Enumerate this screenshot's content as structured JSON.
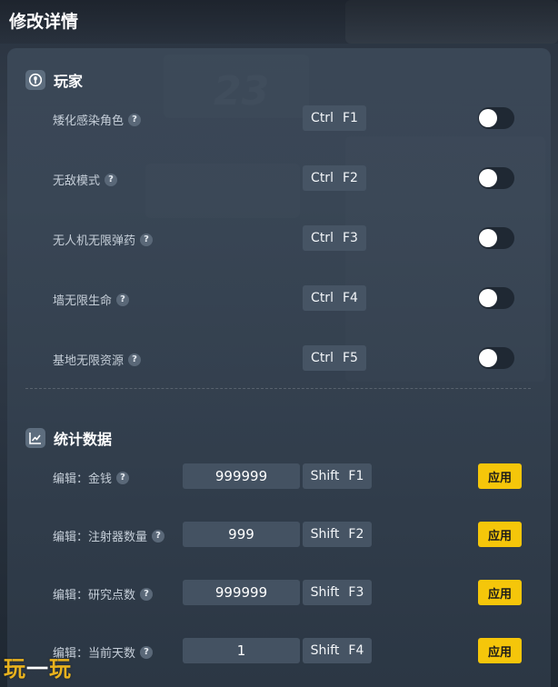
{
  "page": {
    "title": "修改详情"
  },
  "sections": {
    "player": {
      "title": "玩家",
      "icon": "player-icon",
      "items": [
        {
          "label": "矮化感染角色",
          "modifier": "Ctrl",
          "key": "F1",
          "enabled": false
        },
        {
          "label": "无敌模式",
          "modifier": "Ctrl",
          "key": "F2",
          "enabled": false
        },
        {
          "label": "无人机无限弹药",
          "modifier": "Ctrl",
          "key": "F3",
          "enabled": false
        },
        {
          "label": "墙无限生命",
          "modifier": "Ctrl",
          "key": "F4",
          "enabled": false
        },
        {
          "label": "基地无限资源",
          "modifier": "Ctrl",
          "key": "F5",
          "enabled": false
        }
      ]
    },
    "stats": {
      "title": "统计数据",
      "icon": "chart-icon",
      "items": [
        {
          "label": "编辑：金钱",
          "value": "999999",
          "modifier": "Shift",
          "key": "F1",
          "apply_label": "应用"
        },
        {
          "label": "编辑：注射器数量",
          "value": "999",
          "modifier": "Shift",
          "key": "F2",
          "apply_label": "应用"
        },
        {
          "label": "编辑：研究点数",
          "value": "999999",
          "modifier": "Shift",
          "key": "F3",
          "apply_label": "应用"
        },
        {
          "label": "编辑：当前天数",
          "value": "1",
          "modifier": "Shift",
          "key": "F4",
          "apply_label": "应用"
        }
      ]
    }
  },
  "help_glyph": "?",
  "watermark": {
    "left": "玩",
    "mid": "一",
    "right": "玩"
  },
  "colors": {
    "accent_button": "#f5c60a",
    "panel": "#3e4c5c",
    "hotkey_bg": "#465464",
    "toggle_off_track": "#1f2833"
  }
}
